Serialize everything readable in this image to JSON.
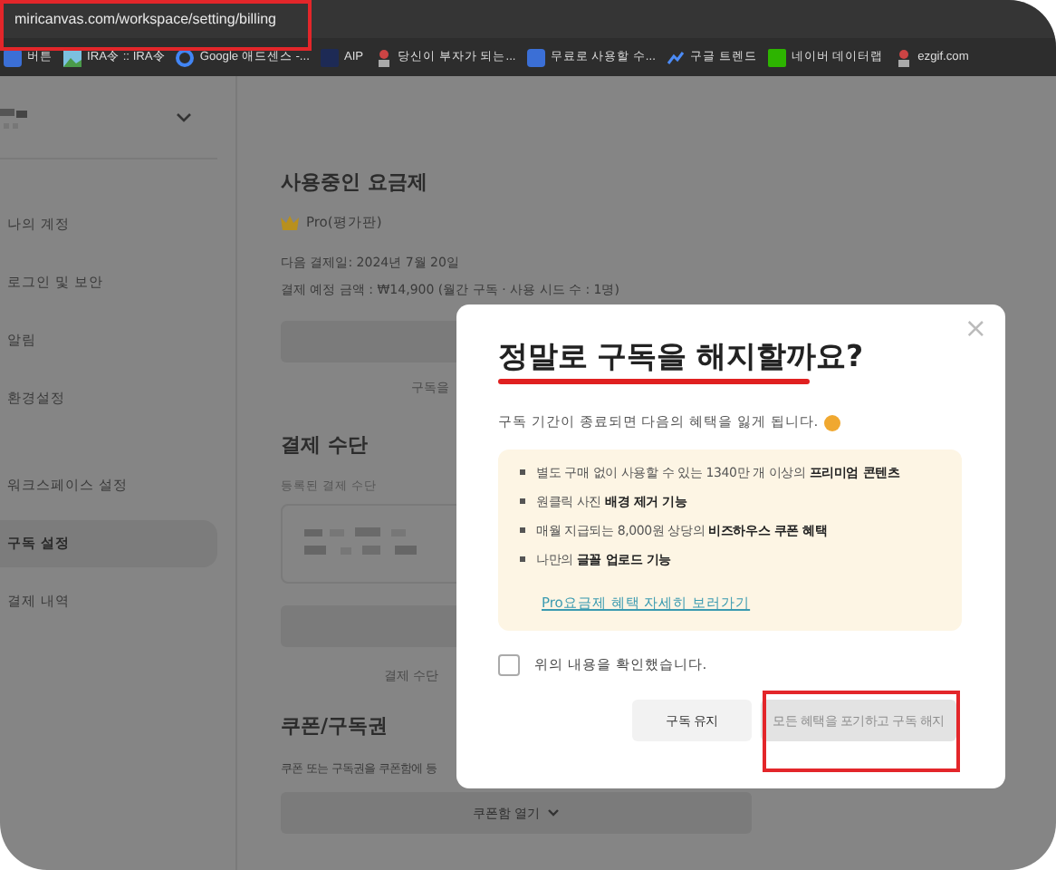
{
  "browser": {
    "url": "miricanvas.com/workspace/setting/billing",
    "bookmarks": [
      {
        "label": "버튼"
      },
      {
        "label": "IRA令 :: IRA令"
      },
      {
        "label": "Google 애드센스 -..."
      },
      {
        "label": "AIP"
      },
      {
        "label": "당신이 부자가 되는..."
      },
      {
        "label": "무료로 사용할 수..."
      },
      {
        "label": "구글 트렌드"
      },
      {
        "label": "네이버 데이터랩"
      },
      {
        "label": "ezgif.com"
      }
    ]
  },
  "sidebar": {
    "items": [
      {
        "label": "나의 계정",
        "selected": false
      },
      {
        "label": "로그인 및 보안",
        "selected": false
      },
      {
        "label": "알림",
        "selected": false
      },
      {
        "label": "환경설정",
        "selected": false
      },
      {
        "label": "워크스페이스 설정",
        "selected": false,
        "group_start": true
      },
      {
        "label": "구독 설정",
        "selected": true
      },
      {
        "label": "결제 내역",
        "selected": false
      }
    ]
  },
  "plan": {
    "heading": "사용중인 요금제",
    "name": "Pro(평가판)",
    "next_billing": "다음 결제일: 2024년 7월 20일",
    "amount": "결제 예정 금액 : ₩14,900 (월간 구독 · 사용 시드 수 : 1명)",
    "note": "구독을"
  },
  "payment": {
    "heading": "결제 수단",
    "label": "등록된 결제 수단",
    "note": "결제 수단"
  },
  "coupon": {
    "heading": "쿠폰/구독권",
    "description": "쿠폰 또는 구독권을 쿠폰함에 등",
    "button": "쿠폰함 열기"
  },
  "dialog": {
    "close": "×",
    "title": "정말로 구독을 해지할까요?",
    "subtitle": "구독 기간이 종료되면 다음의 혜택을 잃게 됩니다.",
    "benefits": [
      "별도 구매 없이 사용할 수 있는 1340만 개 이상의 **프리미엄 콘텐츠**",
      "원클릭 사진 **배경 제거 기능**",
      "매월 지급되는 8,000원 상당의 **비즈하우스 쿠폰 혜택**",
      "나만의 **글꼴 업로드 기능**"
    ],
    "link": "Pro요금제 혜택 자세히 보러가기",
    "confirm": {
      "label": "위의 내용을 확인했습니다.",
      "checked": false
    },
    "buttons": [
      {
        "label": "구독 유지",
        "disabled": false
      },
      {
        "label": "모든 혜택을 포기하고 구독 해지",
        "disabled": true
      }
    ]
  }
}
